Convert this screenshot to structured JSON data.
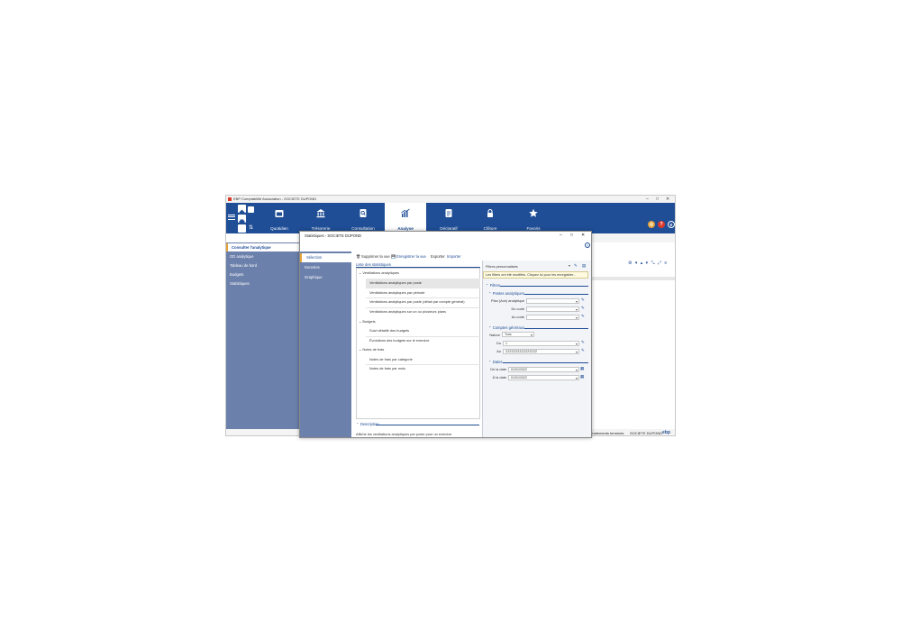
{
  "window": {
    "title": "EBP Comptabilité Association - SOCIETE DUPOND",
    "controls": [
      "–",
      "□",
      "✕"
    ]
  },
  "ribbon": {
    "tabs": [
      {
        "label": "Quotidien",
        "icon": "calendar-icon"
      },
      {
        "label": "Trésorerie",
        "icon": "bank-icon"
      },
      {
        "label": "Consultation",
        "icon": "search-document-icon"
      },
      {
        "label": "Analyse",
        "icon": "chart-icon",
        "active": true
      },
      {
        "label": "Déclaratif",
        "icon": "declaration-icon"
      },
      {
        "label": "Clôture",
        "icon": "lock-icon"
      },
      {
        "label": "Favoris",
        "icon": "star-icon"
      }
    ],
    "circle_icons": [
      {
        "glyph": "◎",
        "color": "#e2a33b"
      },
      {
        "glyph": "?",
        "color": "#d9392b"
      },
      {
        "glyph": "e",
        "color": "#1f4e96"
      }
    ]
  },
  "sidebar": {
    "items": [
      {
        "label": "Consulter l'analytique",
        "selected": true
      },
      {
        "label": "OD analytique"
      },
      {
        "label": "Tableau de bord"
      },
      {
        "label": "Budgets"
      },
      {
        "label": "Statistiques"
      }
    ]
  },
  "statusbar": {
    "text": "Traitements terminés",
    "company": "SOCIETE DUPOND",
    "brand": "ebp"
  },
  "dialog": {
    "title": "Statistiques - SOCIETE DUPOND",
    "controls": [
      "–",
      "□",
      "✕"
    ],
    "help": "?",
    "nav": [
      {
        "label": "Sélection",
        "selected": true
      },
      {
        "label": "Données"
      },
      {
        "label": "Graphique"
      }
    ],
    "toolbar": {
      "delete": "Supprimer la vue",
      "save": "Enregistrer la vue",
      "export": "Exporter",
      "import": "Importer"
    },
    "list_title": "Liste des statistiques",
    "tree": [
      {
        "label": "Ventilations analytiques",
        "level": 0,
        "expanded": true
      },
      {
        "label": "Ventilations analytiques par poste",
        "level": 1,
        "selected": true
      },
      {
        "label": "Ventilations analytiques par période",
        "level": 1
      },
      {
        "label": "Ventilations analytiques par poste (détail par compte général)",
        "level": 1
      },
      {
        "label": "Ventilations analytiques sur un ou plusieurs plans",
        "level": 1
      },
      {
        "label": "Budgets",
        "level": 0,
        "expanded": true
      },
      {
        "label": "Suivi détaillé des budgets",
        "level": 1
      },
      {
        "label": "Évolutions des budgets sur le exercice",
        "level": 1
      },
      {
        "label": "Notes de frais",
        "level": 0,
        "expanded": true
      },
      {
        "label": "Notes de frais par catégorie",
        "level": 1
      },
      {
        "label": "Notes de frais par mois",
        "level": 1
      }
    ],
    "description": {
      "title": "Description",
      "text": "Affiche les ventilations analytiques par poste pour un exercice"
    },
    "filters": {
      "custom_label": "Filtres personnalisés",
      "tooltip": "Les filtres ont été modifiés. Cliquez ici pour les enregistrer...",
      "section_title": "Filtres",
      "postes": {
        "title": "Postes analytiques",
        "plan_label": "Plan (Axe) analytique",
        "from_label": "Du code",
        "to_label": "Au code"
      },
      "comptes": {
        "title": "Comptes généraux",
        "nature_label": "Nature",
        "nature_value": "Tous",
        "from_label": "Du",
        "from_value": "1",
        "to_label": "Au",
        "to_value": "ZZZZZZZZZZZZZZZZ"
      },
      "dates": {
        "title": "Dates",
        "from_label": "De la date",
        "from_value": "01/01/2022",
        "to_label": "À la date",
        "to_value": "01/01/2022"
      }
    }
  },
  "colors": {
    "ribbon": "#1f4e96",
    "sidebar": "#6b80ab",
    "accent": "#e2a33b"
  }
}
